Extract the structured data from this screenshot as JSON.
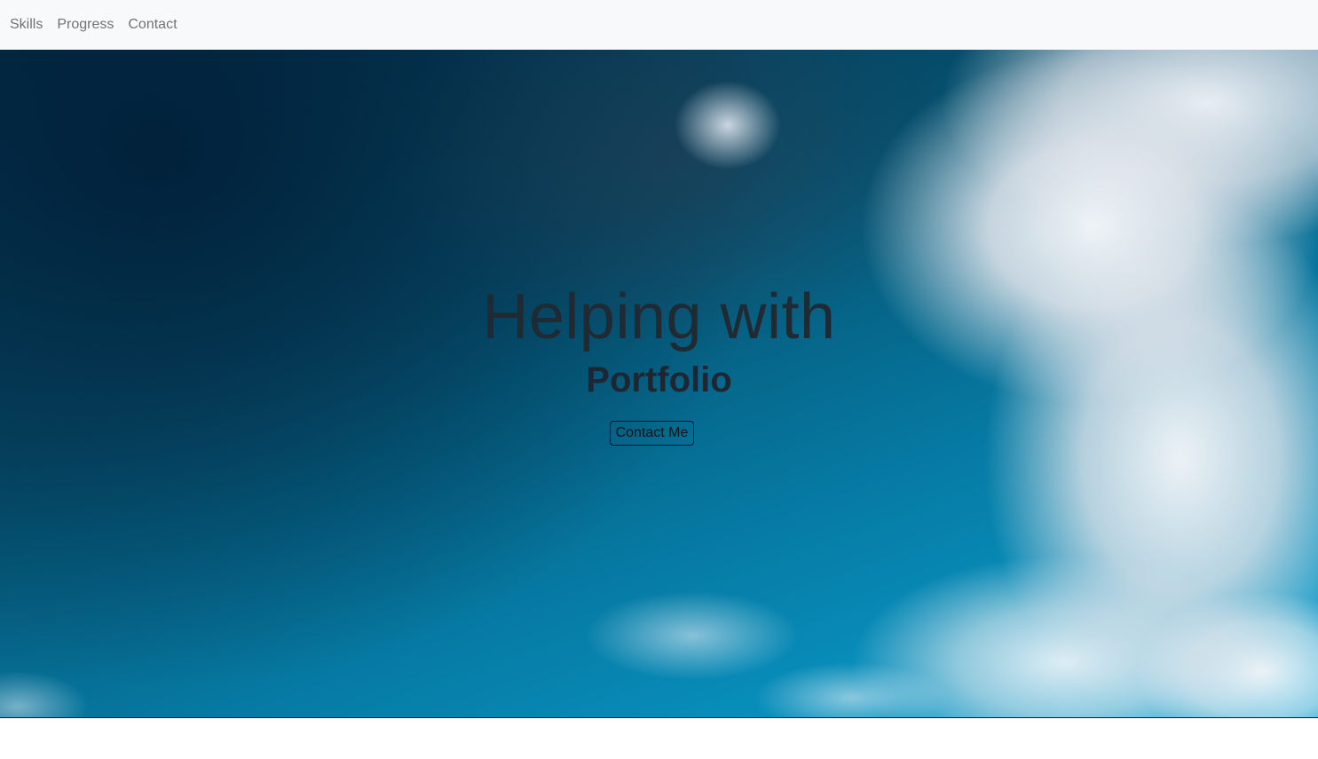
{
  "nav": {
    "items": [
      {
        "label": "Skills"
      },
      {
        "label": "Progress"
      },
      {
        "label": "Contact"
      }
    ]
  },
  "hero": {
    "title": "Helping with",
    "subtitle": "Portfolio",
    "button_label": "Contact Me",
    "background": "sky-with-clouds"
  },
  "colors": {
    "navbar_bg": "#f8f9fa",
    "nav_link": "#6c757d",
    "hero_text": "#1f2a33",
    "sky_dark": "#03314d",
    "sky_light": "#0aa3d4"
  }
}
